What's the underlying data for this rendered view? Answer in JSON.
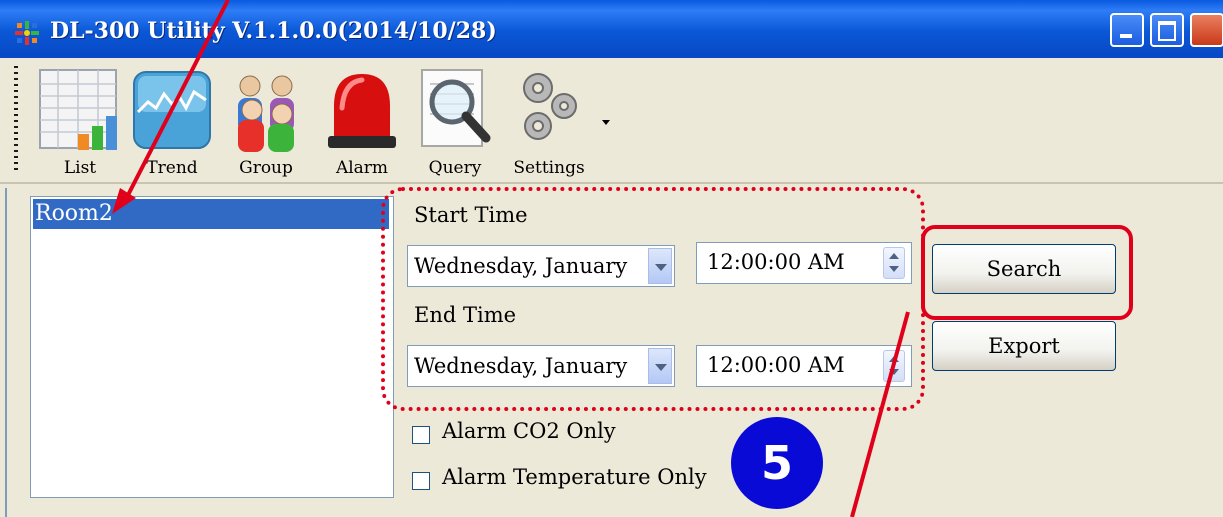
{
  "window": {
    "title": "DL-300 Utility V.1.1.0.0(2014/10/28)"
  },
  "toolbar": {
    "items": [
      {
        "label": "List",
        "icon": "list-icon"
      },
      {
        "label": "Trend",
        "icon": "trend-icon"
      },
      {
        "label": "Group",
        "icon": "group-icon"
      },
      {
        "label": "Alarm",
        "icon": "alarm-icon"
      },
      {
        "label": "Query",
        "icon": "query-icon"
      },
      {
        "label": "Settings",
        "icon": "settings-icon"
      }
    ]
  },
  "devices": [
    "Room2"
  ],
  "query": {
    "start_label": "Start Time",
    "start_date": "Wednesday,  January",
    "start_time": "12:00:00 AM",
    "end_label": "End Time",
    "end_date": "Wednesday,  January",
    "end_time": "12:00:00 AM",
    "alarm_co2_label": "Alarm CO2 Only",
    "alarm_temp_label": "Alarm Temperature Only",
    "alarm_co2_checked": false,
    "alarm_temp_checked": false
  },
  "buttons": {
    "search": "Search",
    "export": "Export"
  },
  "annotation": {
    "step": "5",
    "highlight_color": "#E0001B",
    "badge_color": "#0A0AD6"
  }
}
